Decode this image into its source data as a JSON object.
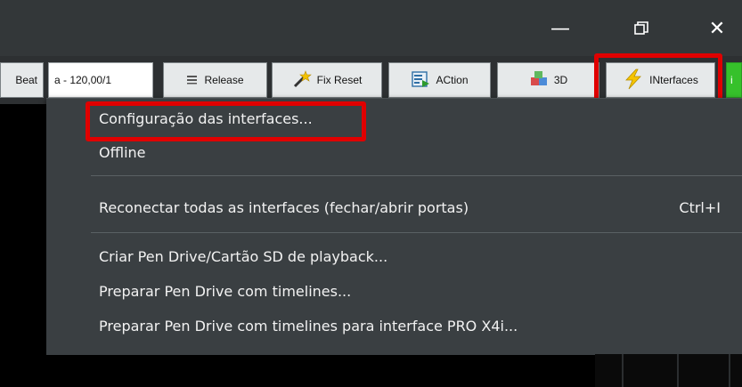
{
  "window": {
    "minimize_glyph": "—",
    "restore_glyph": "❐",
    "close_glyph": "✕"
  },
  "toolbar": {
    "beat_label": "Beat",
    "tempo_value": "a - 120,00/1",
    "release_label": "Release",
    "fixreset_label": "Fix Reset",
    "action_label": "ACtion",
    "three_d_label": "3D",
    "interfaces_label": "INterfaces",
    "extra_label": "i",
    "icons": {
      "release": "equals-icon",
      "fixreset": "magic-wand-icon",
      "action": "action-icon",
      "three_d": "cubes-icon",
      "interfaces": "lightning-icon"
    }
  },
  "menu": {
    "items": [
      {
        "label": "Configuração das interfaces...",
        "shortcut": ""
      },
      {
        "label": "Offline",
        "shortcut": ""
      },
      {
        "label": "Reconectar todas as interfaces (fechar/abrir portas)",
        "shortcut": "Ctrl+I"
      },
      {
        "label": "Criar Pen Drive/Cartão SD de playback...",
        "shortcut": ""
      },
      {
        "label": "Preparar Pen Drive com timelines...",
        "shortcut": ""
      },
      {
        "label": "Preparar Pen Drive com timelines para interface PRO X4i...",
        "shortcut": ""
      }
    ]
  },
  "colors": {
    "highlight": "#e00000",
    "menu_bg": "#3a3f42",
    "green_button": "#36c12b"
  }
}
